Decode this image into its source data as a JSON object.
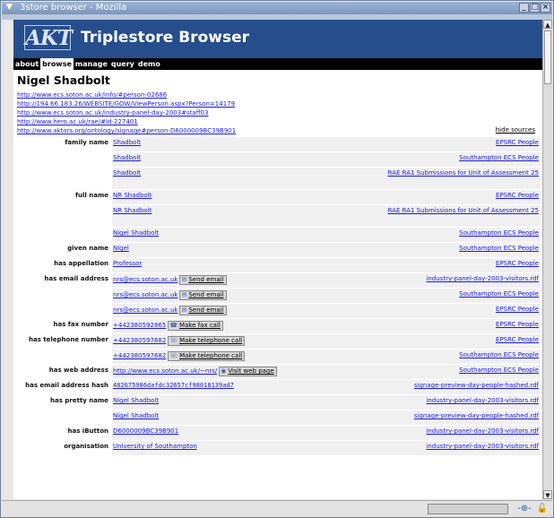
{
  "window": {
    "title": "3store browser - Mozilla",
    "tabs_text": "",
    "controls": [
      "_",
      "□",
      "×"
    ]
  },
  "app": {
    "logo": "AKT",
    "title": "Triplestore Browser"
  },
  "nav": [
    {
      "label": "about",
      "active": false
    },
    {
      "label": "browse",
      "active": true
    },
    {
      "label": "manage",
      "active": false
    },
    {
      "label": "query",
      "active": false
    },
    {
      "label": "demo",
      "active": false
    }
  ],
  "page": {
    "heading": "Nigel Shadbolt",
    "hide_sources": "hide sources"
  },
  "sources": [
    "http://www.ecs.soton.ac.uk/info/#person-02686",
    "http://194.66.183.26/WEBSITE/GOW/ViewPerson.aspx?Person=14179",
    "http://www.ecs.soton.ac.uk/industry-panel-day-2003#staff03",
    "http://www.hero.ac.uk/rae/#Id-227401",
    "http://www.aktors.org/ontology/signage#person-D6000009BC39B901"
  ],
  "rows": [
    {
      "prop": "family name",
      "value": "Shadbolt",
      "source": "EPSRC People"
    },
    {
      "prop": "",
      "value": "Shadbolt",
      "source": "Southampton ECS People"
    },
    {
      "prop": "",
      "value": "Shadbolt",
      "source": "RAE RA1 Submissions for Unit of Assessment 25"
    },
    {
      "prop": "full name",
      "value": "NR Shadbolt",
      "source": "EPSRC People"
    },
    {
      "prop": "",
      "value": "NR Shadbolt",
      "source": "RAE RA1 Submissions for Unit of Assessment 25"
    },
    {
      "prop": "",
      "value": "Nigel Shadbolt",
      "source": "Southampton ECS People"
    },
    {
      "prop": "given name",
      "value": "Nigel",
      "source": "Southampton ECS People"
    },
    {
      "prop": "has appellation",
      "value": "Professor",
      "source": "EPSRC People"
    },
    {
      "prop": "has email address",
      "value": "nrs@ecs.soton.ac.uk",
      "button": "Send email",
      "icon": "envelope-icon",
      "source": "industry-panel-day-2003-visitors.rdf"
    },
    {
      "prop": "",
      "value": "nrs@ecs.soton.ac.uk",
      "button": "Send email",
      "icon": "envelope-icon",
      "source": "Southampton ECS People"
    },
    {
      "prop": "",
      "value": "nrs@ecs.soton.ac.uk",
      "button": "Send email",
      "icon": "envelope-icon",
      "source": "EPSRC People"
    },
    {
      "prop": "has fax number",
      "value": "+442380592865",
      "button": "Make fax call",
      "icon": "fax-icon",
      "source": "EPSRC People"
    },
    {
      "prop": "has telephone number",
      "value": "+442380597682",
      "button": "Make telephone call",
      "icon": "telephone-icon",
      "source": "EPSRC People"
    },
    {
      "prop": "",
      "value": "+442380597682",
      "button": "Make telephone call",
      "icon": "telephone-icon",
      "source": "Southampton ECS People"
    },
    {
      "prop": "has web address",
      "value": "http://www.ecs.soton.ac.uk/~nrs/",
      "button": "Visit web page",
      "icon": "globe-icon",
      "source": "Southampton ECS People"
    },
    {
      "prop": "has email address hash",
      "value": "482675986dafdc32657cf98018139ad7",
      "source": "signage-preview-day-people-hashed.rdf"
    },
    {
      "prop": "has pretty name",
      "value": "Nigel Shadbolt",
      "source": "industry-panel-day-2003-visitors.rdf"
    },
    {
      "prop": "",
      "value": "Nigel Shadbolt",
      "source": "signage-preview-day-people-hashed.rdf"
    },
    {
      "prop": "has iButton",
      "value": "D6000009BC39B901",
      "source": "industry-panel-day-2003-visitors.rdf"
    },
    {
      "prop": "organisation",
      "value": "University of Southampton",
      "source": "industry-panel-day-2003-visitors.rdf"
    }
  ],
  "icons": {
    "envelope-icon": "✉",
    "fax-icon": "☎",
    "telephone-icon": "☏",
    "globe-icon": "◉"
  }
}
